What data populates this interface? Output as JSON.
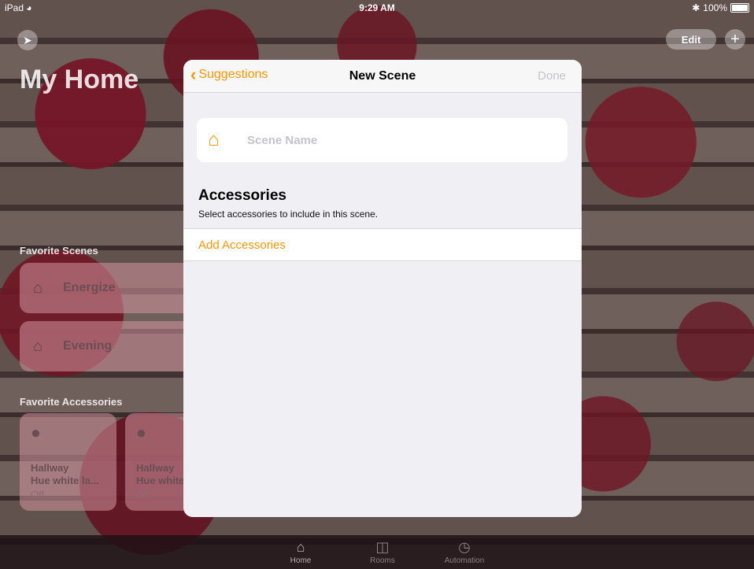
{
  "status_bar": {
    "device": "iPad",
    "wifi_icon": "wifi-icon",
    "time": "9:29 AM",
    "bluetooth_icon": "bluetooth-icon",
    "battery": "100%"
  },
  "home": {
    "title": "My Home",
    "edit_label": "Edit",
    "add_icon": "plus-icon",
    "location_icon": "location-arrow-icon",
    "favorite_scenes_label": "Favorite Scenes",
    "scenes": [
      {
        "label": "Energize",
        "icon": "house-icon"
      },
      {
        "label": "Evening",
        "icon": "house-icon"
      }
    ],
    "favorite_accessories_label": "Favorite Accessories",
    "accessories": [
      {
        "room": "Hallway",
        "name": "Hue white la...",
        "state": "Off",
        "icon": "lightbulb-icon"
      },
      {
        "room": "Hallway",
        "name": "Hue white",
        "state": "Off",
        "icon": "lightbulb-icon"
      }
    ]
  },
  "tabbar": {
    "tabs": [
      {
        "label": "Home",
        "icon": "house-icon",
        "active": true
      },
      {
        "label": "Rooms",
        "icon": "rooms-icon",
        "active": false
      },
      {
        "label": "Automation",
        "icon": "clock-check-icon",
        "active": false
      }
    ]
  },
  "modal": {
    "back_label": "Suggestions",
    "title": "New Scene",
    "done_label": "Done",
    "scene_name_placeholder": "Scene Name",
    "accessories_header": "Accessories",
    "accessories_subtitle": "Select accessories to include in this scene.",
    "add_accessories_label": "Add Accessories",
    "accent_color": "#ff9500"
  }
}
